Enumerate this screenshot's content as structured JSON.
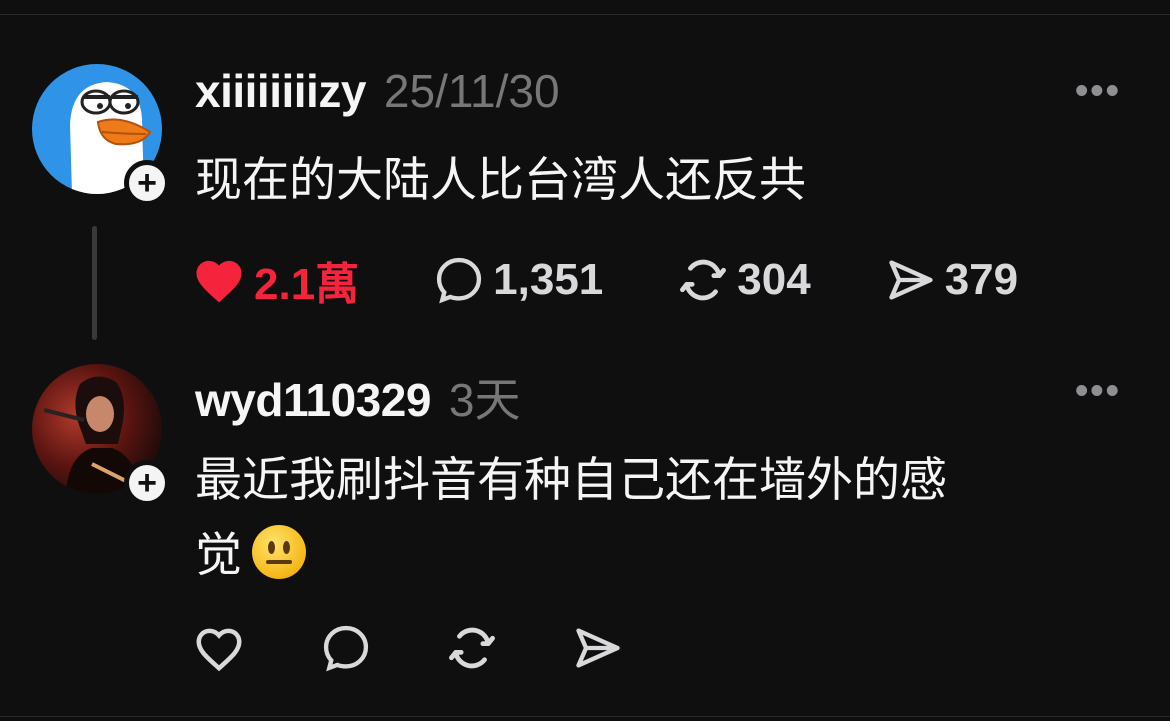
{
  "posts": [
    {
      "username": "xiiiiiiiizy",
      "timestamp": "25/11/30",
      "text": "现在的大陆人比台湾人还反共",
      "avatar": "goose-cartoon",
      "follow_icon": "plus-icon",
      "more_icon": "more-horizontal-icon",
      "liked": true,
      "counts": {
        "likes": "2.1萬",
        "replies": "1,351",
        "reposts": "304",
        "shares": "379"
      }
    },
    {
      "username": "wyd110329",
      "timestamp": "3天",
      "text_line1": "最近我刷抖音有种自己还在墙外的感",
      "text_line2": "觉",
      "emoji": "neutral-face",
      "avatar": "person-photo",
      "follow_icon": "plus-icon",
      "more_icon": "more-horizontal-icon",
      "liked": false
    }
  ],
  "colors": {
    "background": "#0f0f10",
    "like_red": "#f5233c",
    "muted": "#77777a"
  },
  "ui": {
    "follow_symbol": "+",
    "more_symbol": "•••"
  }
}
